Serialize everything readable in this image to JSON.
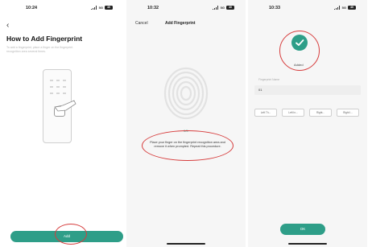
{
  "screens": [
    {
      "status": {
        "time": "10:24",
        "network": "5G",
        "battery": "40"
      },
      "title": "How to Add Fingerprint",
      "description": "To add a fingerprint, place a finger on the fingerprint recognition area several times.",
      "button": "Add"
    },
    {
      "status": {
        "time": "10:32",
        "network": "5G",
        "battery": "40"
      },
      "cancel": "Cancel",
      "title": "Add Fingerprint",
      "progress": "0/5",
      "instruction": "Place your finger on the fingerprint recognition area and remove it when prompted. Repeat this procedure."
    },
    {
      "status": {
        "time": "10:33",
        "network": "5G",
        "battery": "40"
      },
      "status_text": "Added",
      "field_label": "Fingerprint Name",
      "field_value": "01",
      "chips": [
        "Left Th...",
        "Left In...",
        "Right...",
        "Right I..."
      ],
      "button": "OK"
    }
  ],
  "colors": {
    "accent": "#2e9e88",
    "annotation": "#d63c3c"
  }
}
